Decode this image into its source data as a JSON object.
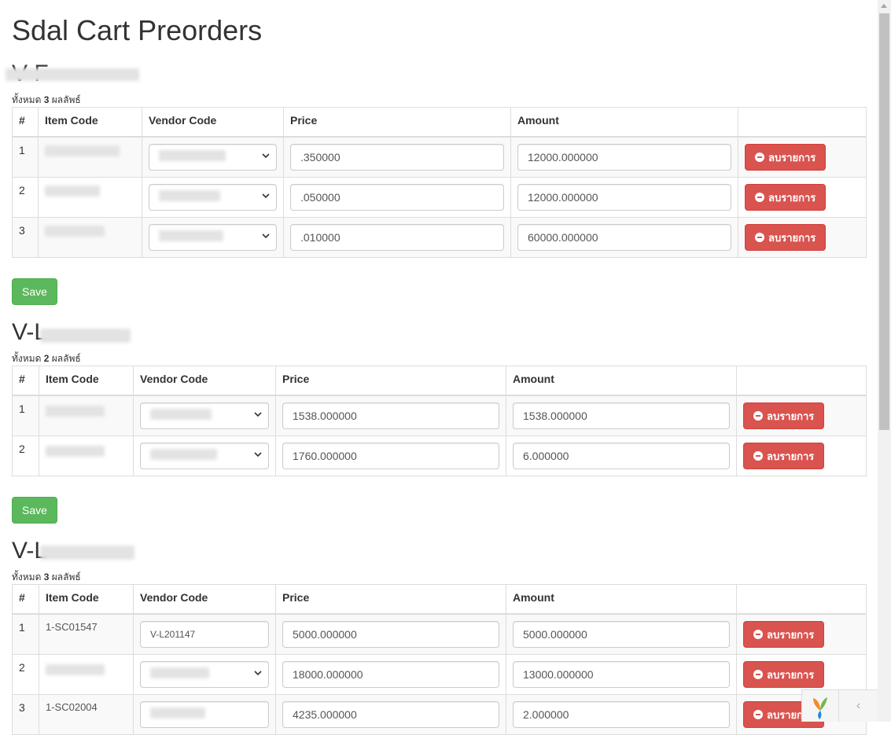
{
  "page": {
    "title": "Sdal Cart Preorders"
  },
  "labels": {
    "summary_prefix": "ทั้งหมด",
    "summary_suffix": "ผลลัพธ์",
    "delete_label": "ลบรายการ",
    "save_label": "Save"
  },
  "columns": [
    "#",
    "Item Code",
    "Vendor Code",
    "Price",
    "Amount",
    ""
  ],
  "sections": [
    {
      "title": "V-F",
      "count": "3",
      "rows": [
        {
          "no": "1",
          "price": ".350000",
          "amount": "12000.000000"
        },
        {
          "no": "2",
          "price": ".050000",
          "amount": "12000.000000"
        },
        {
          "no": "3",
          "price": ".010000",
          "amount": "60000.000000"
        }
      ]
    },
    {
      "title": "V-L",
      "count": "2",
      "rows": [
        {
          "no": "1",
          "price": "1538.000000",
          "amount": "1538.000000"
        },
        {
          "no": "2",
          "price": "1760.000000",
          "amount": "6.000000"
        }
      ]
    },
    {
      "title": "V-L",
      "count": "3",
      "rows": [
        {
          "no": "1",
          "item": "1-SC01547",
          "vendor": "V-L201147",
          "price": "5000.000000",
          "amount": "5000.000000"
        },
        {
          "no": "2",
          "price": "18000.000000",
          "amount": "13000.000000"
        },
        {
          "no": "3",
          "item": "1-SC02004",
          "price": "4235.000000",
          "amount": "2.000000"
        }
      ]
    }
  ],
  "colors": {
    "danger": "#d9534f",
    "success": "#5cb85c"
  }
}
